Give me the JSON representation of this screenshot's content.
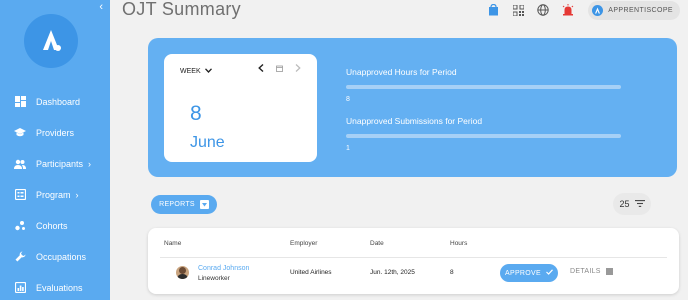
{
  "page": {
    "title": "OJT Summary"
  },
  "header": {
    "icons": [
      "store-icon",
      "qr-code-icon",
      "globe-icon",
      "alarm-icon"
    ],
    "brand_label": "APPRENTISCOPE"
  },
  "sidebar": {
    "items": [
      {
        "label": "Dashboard",
        "icon": "dashboard-icon",
        "has_submenu": false
      },
      {
        "label": "Providers",
        "icon": "graduation-cap-icon",
        "has_submenu": false
      },
      {
        "label": "Participants",
        "icon": "people-icon",
        "has_submenu": true
      },
      {
        "label": "Program",
        "icon": "program-icon",
        "has_submenu": true
      },
      {
        "label": "Cohorts",
        "icon": "cohorts-icon",
        "has_submenu": false
      },
      {
        "label": "Occupations",
        "icon": "wrench-icon",
        "has_submenu": false
      },
      {
        "label": "Evaluations",
        "icon": "evaluations-icon",
        "has_submenu": false
      }
    ]
  },
  "summary": {
    "period_select": "WEEK",
    "day": "8",
    "month": "June",
    "metrics": [
      {
        "label": "Unapproved Hours for Period",
        "value": "8"
      },
      {
        "label": "Unapproved Submissions for Period",
        "value": "1"
      }
    ]
  },
  "toolbar": {
    "reports_label": "REPORTS",
    "per_page": "25"
  },
  "table": {
    "columns": [
      "Name",
      "Employer",
      "Date",
      "Hours"
    ],
    "rows": [
      {
        "name": "Conrad Johnson",
        "role": "Lineworker",
        "employer": "United Airlines",
        "date": "Jun. 12th, 2025",
        "hours": "8",
        "approve_label": "APPROVE",
        "details_label": "DETAILS"
      }
    ]
  },
  "colors": {
    "accent": "#5aaaf0",
    "summary_bg": "#64b0f2",
    "page_bg": "#f1f1f1"
  }
}
